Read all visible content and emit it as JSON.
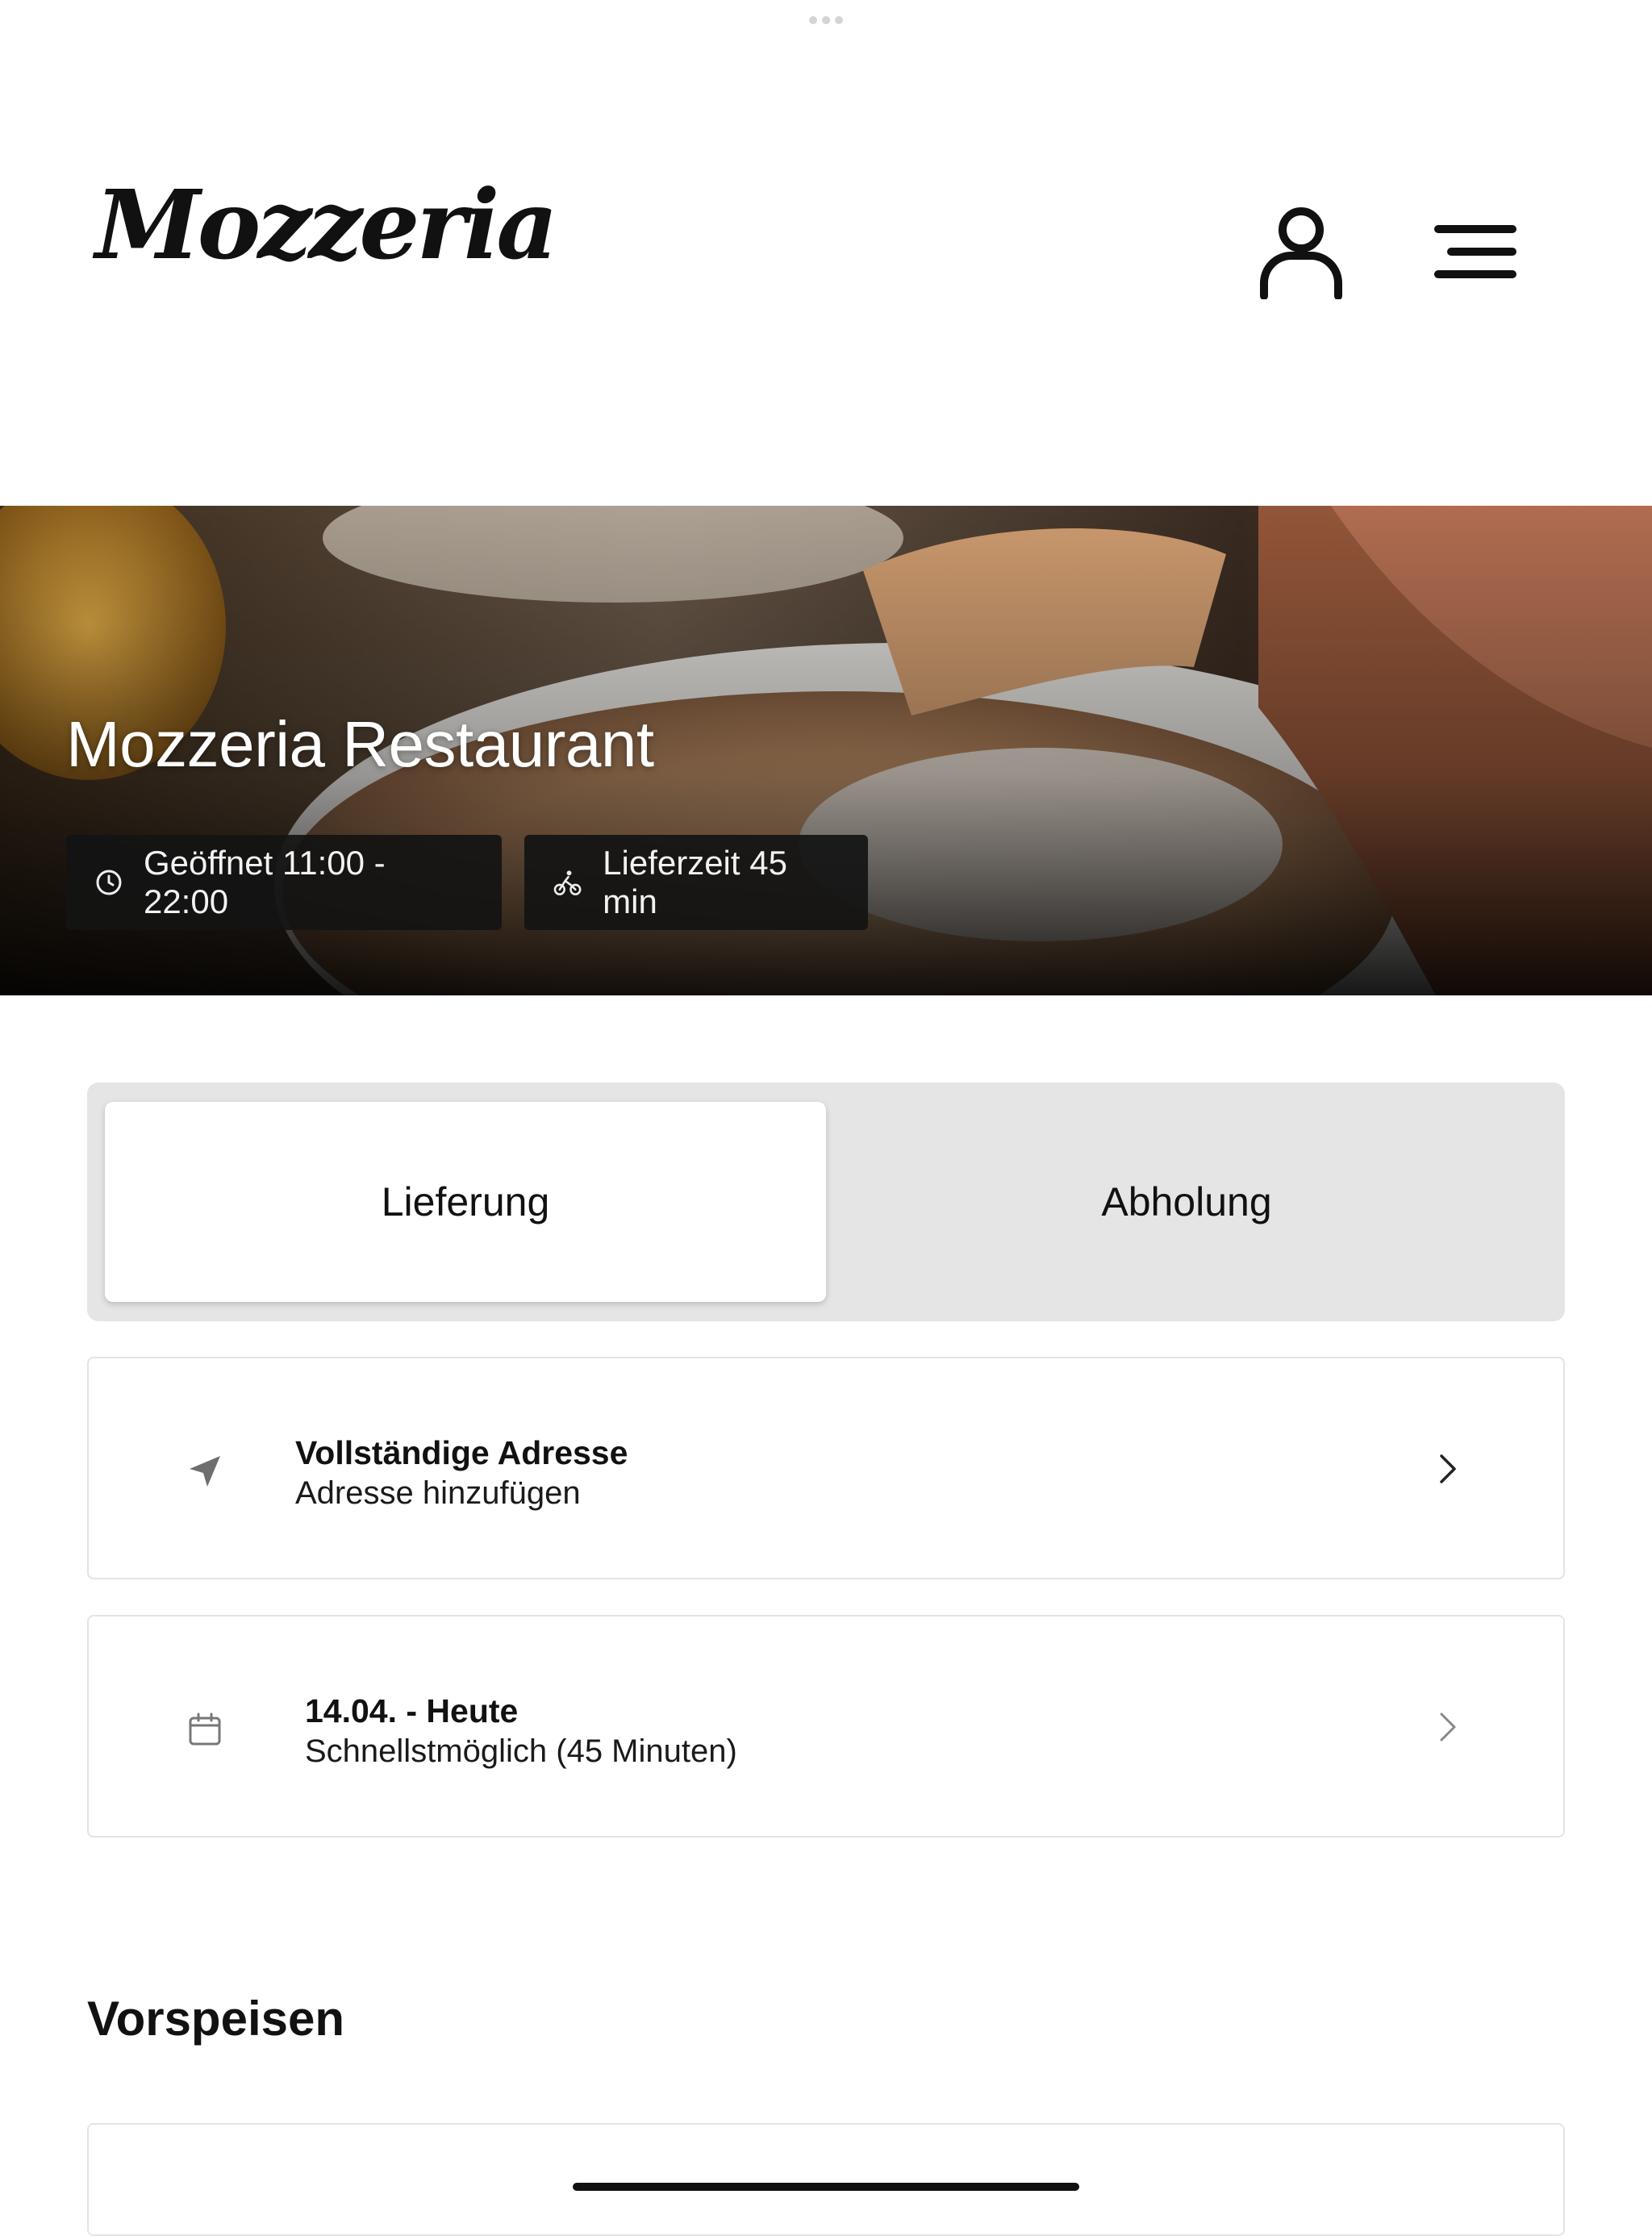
{
  "brand": {
    "logo_text": "Mozzeria"
  },
  "header": {
    "user_icon": "user-icon",
    "menu_icon": "hamburger-menu-icon"
  },
  "hero": {
    "title": "Mozzeria Restaurant",
    "hours_icon": "clock-icon",
    "hours_label": "Geöffnet 11:00 - 22:00",
    "delivery_icon": "cyclist-icon",
    "delivery_label": "Lieferzeit 45 min"
  },
  "order_mode": {
    "options": [
      {
        "label": "Lieferung",
        "selected": true
      },
      {
        "label": "Abholung",
        "selected": false
      }
    ]
  },
  "address_card": {
    "icon": "location-arrow-icon",
    "title": "Vollständige Adresse",
    "subtitle": "Adresse hinzufügen"
  },
  "date_card": {
    "icon": "calendar-icon",
    "title": "14.04. - Heute",
    "subtitle": "Schnellstmöglich (45 Minuten)"
  },
  "menu": {
    "section_title": "Vorspeisen"
  },
  "colors": {
    "segment_bg": "#e5e5e5",
    "pill_bg": "#141414",
    "text": "#111111"
  }
}
